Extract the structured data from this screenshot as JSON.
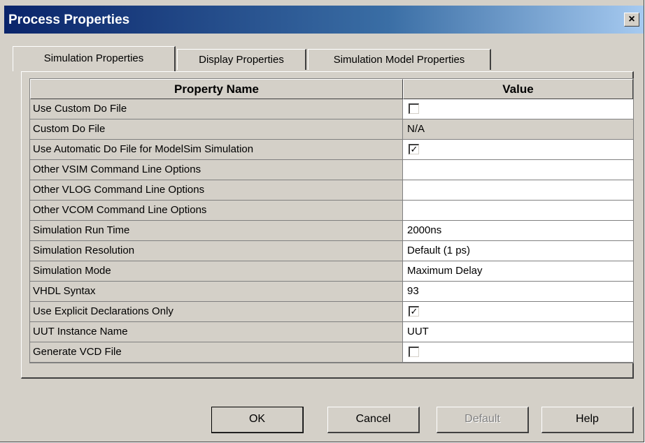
{
  "window": {
    "title": "Process Properties",
    "close_glyph": "×"
  },
  "tabs": [
    {
      "label": "Simulation Properties",
      "active": true
    },
    {
      "label": "Display Properties",
      "active": false
    },
    {
      "label": "Simulation Model Properties",
      "active": false
    }
  ],
  "grid": {
    "headers": {
      "name": "Property Name",
      "value": "Value"
    },
    "rows": [
      {
        "name": "Use Custom Do File",
        "type": "checkbox",
        "checked": false,
        "value": ""
      },
      {
        "name": "Custom Do File",
        "type": "text",
        "value": "N/A"
      },
      {
        "name": "Use Automatic Do File for ModelSim Simulation",
        "type": "checkbox",
        "checked": true,
        "value": ""
      },
      {
        "name": "Other VSIM Command Line Options",
        "type": "text",
        "value": ""
      },
      {
        "name": "Other VLOG Command Line Options",
        "type": "text",
        "value": ""
      },
      {
        "name": "Other VCOM Command Line Options",
        "type": "text",
        "value": ""
      },
      {
        "name": "Simulation Run Time",
        "type": "text",
        "value": "2000ns"
      },
      {
        "name": "Simulation Resolution",
        "type": "text",
        "value": "Default (1 ps)"
      },
      {
        "name": "Simulation Mode",
        "type": "text",
        "value": "Maximum Delay"
      },
      {
        "name": "VHDL Syntax",
        "type": "text",
        "value": "93"
      },
      {
        "name": "Use Explicit Declarations Only",
        "type": "checkbox",
        "checked": true,
        "value": ""
      },
      {
        "name": "UUT Instance Name",
        "type": "text",
        "value": "UUT"
      },
      {
        "name": "Generate VCD File",
        "type": "checkbox",
        "checked": false,
        "value": ""
      }
    ]
  },
  "buttons": {
    "ok": "OK",
    "cancel": "Cancel",
    "default": "Default",
    "help": "Help"
  },
  "check_glyph": "✓",
  "colors": {
    "titlebar_start": "#0a246a",
    "titlebar_end": "#a6caf0",
    "face": "#d4d0c8"
  }
}
